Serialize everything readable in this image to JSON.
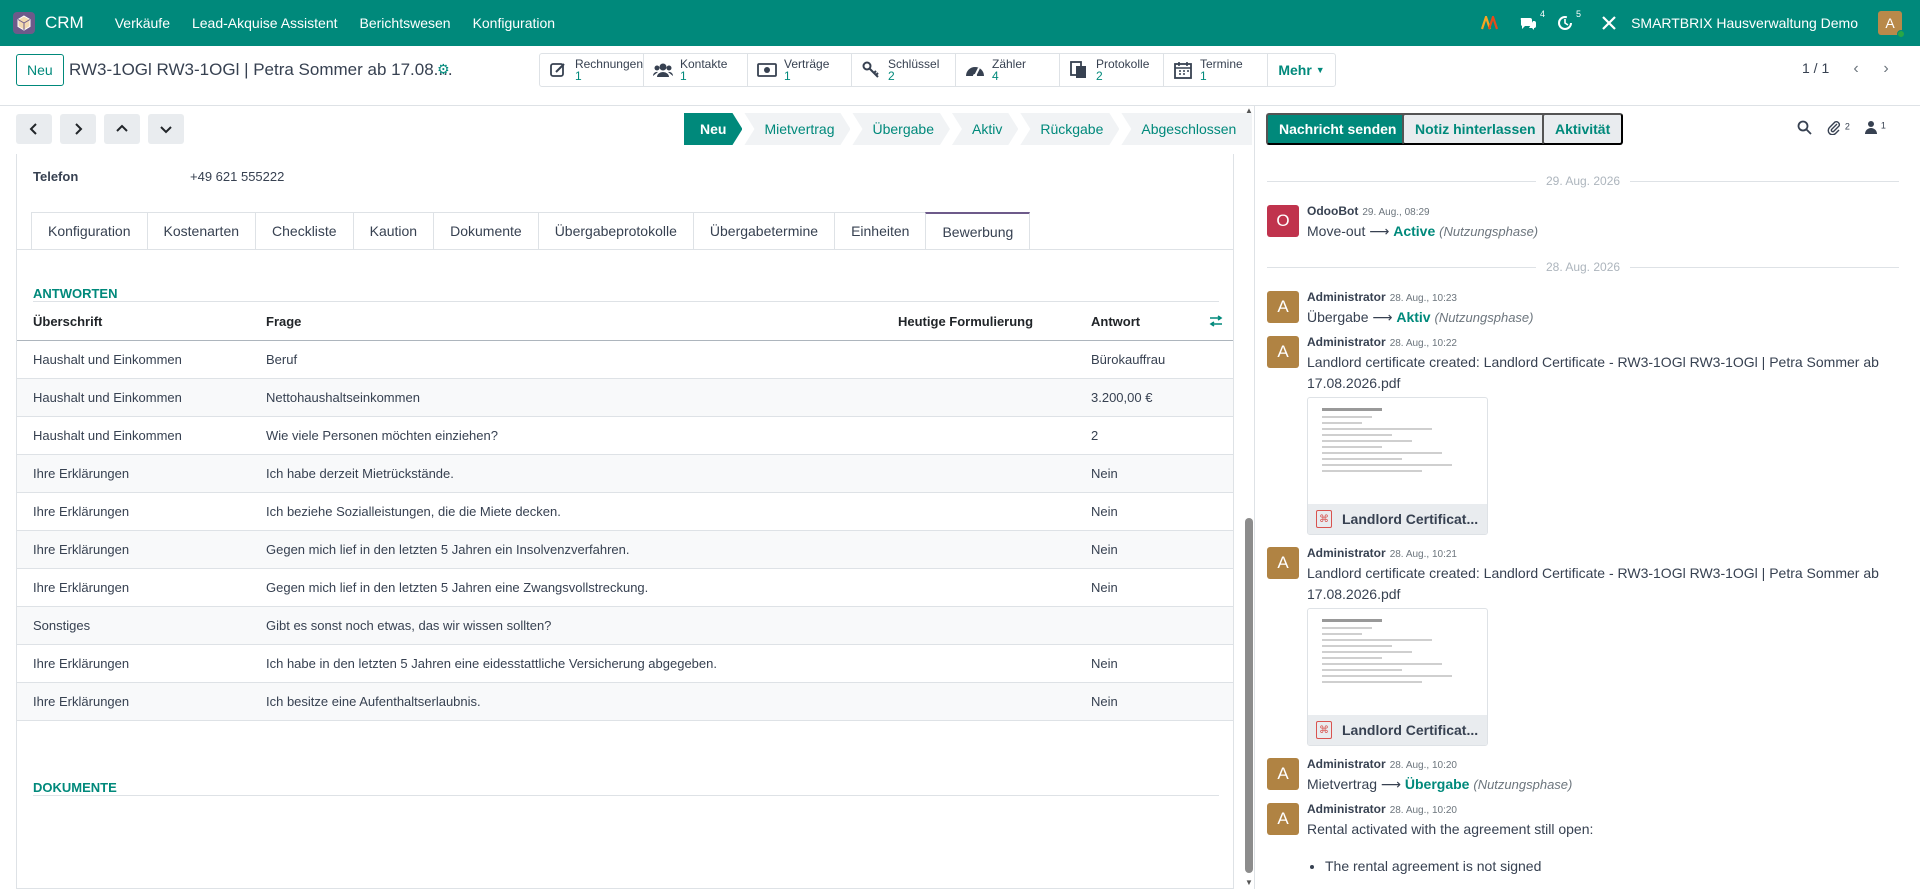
{
  "navbar": {
    "app_name": "CRM",
    "menu": [
      "Verkäufe",
      "Lead-Akquise Assistent",
      "Berichtswesen",
      "Konfiguration"
    ],
    "messages_count": "4",
    "activities_count": "5",
    "company": "SMARTBRIX Hausverwaltung Demo",
    "user_initial": "A"
  },
  "control_panel": {
    "new_label": "Neu",
    "record_title": "RW3-1OGl RW3-1OGl | Petra Sommer ab 17.08....",
    "smart_buttons": [
      {
        "label": "Rechnungen",
        "value": "1",
        "icon": "pencil-square-icon"
      },
      {
        "label": "Kontakte",
        "value": "1",
        "icon": "users-icon"
      },
      {
        "label": "Verträge",
        "value": "1",
        "icon": "money-icon"
      },
      {
        "label": "Schlüssel",
        "value": "2",
        "icon": "key-icon"
      },
      {
        "label": "Zähler",
        "value": "4",
        "icon": "gauge-icon"
      },
      {
        "label": "Protokolle",
        "value": "2",
        "icon": "files-icon"
      },
      {
        "label": "Termine",
        "value": "1",
        "icon": "calendar-icon"
      }
    ],
    "more_label": "Mehr",
    "pager": "1 / 1"
  },
  "statusbar": {
    "stages": [
      "Neu",
      "Mietvertrag",
      "Übergabe",
      "Aktiv",
      "Rückgabe",
      "Abgeschlossen"
    ],
    "active": "Neu"
  },
  "form": {
    "phone_label": "Telefon",
    "phone_value": "+49 621 555222",
    "tabs": [
      "Konfiguration",
      "Kostenarten",
      "Checkliste",
      "Kaution",
      "Dokumente",
      "Übergabeprotokolle",
      "Übergabetermine",
      "Einheiten",
      "Bewerbung"
    ],
    "active_tab": "Bewerbung",
    "answers_title": "ANTWORTEN",
    "columns": {
      "c1": "Überschrift",
      "c2": "Frage",
      "c3": "Heutige Formulierung",
      "c4": "Antwort"
    },
    "rows": [
      {
        "c1": "Haushalt und Einkommen",
        "c2": "Beruf",
        "c4": "Bürokauffrau"
      },
      {
        "c1": "Haushalt und Einkommen",
        "c2": "Nettohaushaltseinkommen",
        "c4": "3.200,00 €"
      },
      {
        "c1": "Haushalt und Einkommen",
        "c2": "Wie viele Personen möchten einziehen?",
        "c4": "2"
      },
      {
        "c1": "Ihre Erklärungen",
        "c2": "Ich habe derzeit Mietrückstände.",
        "c4": "Nein"
      },
      {
        "c1": "Ihre Erklärungen",
        "c2": "Ich beziehe Sozialleistungen, die die Miete decken.",
        "c4": "Nein"
      },
      {
        "c1": "Ihre Erklärungen",
        "c2": "Gegen mich lief in den letzten 5 Jahren ein Insolvenzverfahren.",
        "c4": "Nein"
      },
      {
        "c1": "Ihre Erklärungen",
        "c2": "Gegen mich lief in den letzten 5 Jahren eine Zwangsvollstreckung.",
        "c4": "Nein"
      },
      {
        "c1": "Sonstiges",
        "c2": "Gibt es sonst noch etwas, das wir wissen sollten?",
        "c4": ""
      },
      {
        "c1": "Ihre Erklärungen",
        "c2": "Ich habe in den letzten 5 Jahren eine eidesstattliche Versicherung abgegeben.",
        "c4": "Nein"
      },
      {
        "c1": "Ihre Erklärungen",
        "c2": "Ich besitze eine Aufenthaltserlaubnis.",
        "c4": "Nein"
      }
    ],
    "documents_title": "DOKUMENTE"
  },
  "chatter": {
    "send_message": "Nachricht senden",
    "log_note": "Notiz hinterlassen",
    "activity": "Aktivität",
    "attachments_count": "2",
    "followers_count": "1",
    "date1": "29. Aug. 2026",
    "date2": "28. Aug. 2026",
    "msg1": {
      "initial": "O",
      "author": "OdooBot",
      "time": "29. Aug., 08:29",
      "from": "Move-out",
      "to": "Active",
      "field": "(Nutzungsphase)"
    },
    "msg2": {
      "initial": "A",
      "author": "Administrator",
      "time": "28. Aug., 10:23",
      "from": "Übergabe",
      "to": "Aktiv",
      "field": "(Nutzungsphase)"
    },
    "msg3": {
      "initial": "A",
      "author": "Administrator",
      "time": "28. Aug., 10:22",
      "text": "Landlord certificate created: Landlord Certificate - RW3-1OGl RW3-1OGl | Petra Sommer ab 17.08.2026.pdf",
      "attachment": "Landlord Certificat..."
    },
    "msg4": {
      "initial": "A",
      "author": "Administrator",
      "time": "28. Aug., 10:21",
      "text": "Landlord certificate created: Landlord Certificate - RW3-1OGl RW3-1OGl | Petra Sommer ab 17.08.2026.pdf",
      "attachment": "Landlord Certificat..."
    },
    "msg5": {
      "initial": "A",
      "author": "Administrator",
      "time": "28. Aug., 10:20",
      "from": "Mietvertrag",
      "to": "Übergabe",
      "field": "(Nutzungsphase)"
    },
    "msg6": {
      "initial": "A",
      "author": "Administrator",
      "time": "28. Aug., 10:20",
      "text": "Rental activated with the agreement still open:",
      "bullet": "The rental agreement is not signed"
    }
  },
  "colors": {
    "primary": "#00897b",
    "secondary": "#6d5a8a",
    "odoobot": "#c0334d",
    "admin": "#b08343"
  }
}
